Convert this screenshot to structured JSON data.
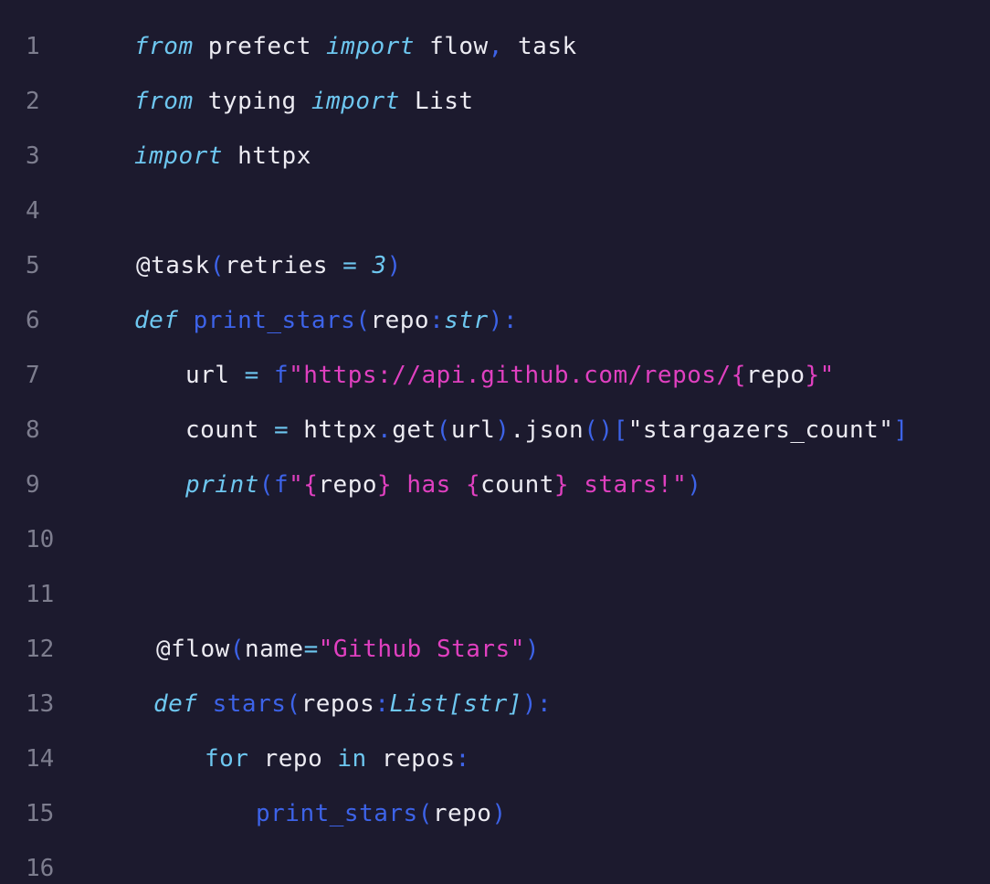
{
  "editor": {
    "theme_colors": {
      "background": "#1c1a2e",
      "line_number": "#7d7d8e",
      "keyword": "#6ec7f0",
      "identifier": "#ecebf2",
      "function": "#3d63e8",
      "string": "#e040c0"
    },
    "lines": [
      {
        "num": "1",
        "indent": 147,
        "tokens": [
          {
            "t": "from",
            "c": "kw"
          },
          {
            "t": " ",
            "c": "id"
          },
          {
            "t": "prefect",
            "c": "id"
          },
          {
            "t": " ",
            "c": "id"
          },
          {
            "t": "import",
            "c": "kw"
          },
          {
            "t": " ",
            "c": "id"
          },
          {
            "t": "flow",
            "c": "id"
          },
          {
            "t": ",",
            "c": "pn"
          },
          {
            "t": " ",
            "c": "id"
          },
          {
            "t": "task",
            "c": "id"
          }
        ]
      },
      {
        "num": "2",
        "indent": 147,
        "tokens": [
          {
            "t": "from",
            "c": "kw"
          },
          {
            "t": " ",
            "c": "id"
          },
          {
            "t": "typing",
            "c": "id"
          },
          {
            "t": " ",
            "c": "id"
          },
          {
            "t": "import",
            "c": "kw"
          },
          {
            "t": " ",
            "c": "id"
          },
          {
            "t": "List",
            "c": "id"
          }
        ]
      },
      {
        "num": "3",
        "indent": 147,
        "tokens": [
          {
            "t": "import",
            "c": "kw"
          },
          {
            "t": " ",
            "c": "id"
          },
          {
            "t": "httpx",
            "c": "id"
          }
        ]
      },
      {
        "num": "4",
        "indent": 147,
        "tokens": []
      },
      {
        "num": "5",
        "indent": 149,
        "tokens": [
          {
            "t": "@task",
            "c": "dec"
          },
          {
            "t": "(",
            "c": "pn"
          },
          {
            "t": "retries",
            "c": "id"
          },
          {
            "t": " ",
            "c": "id"
          },
          {
            "t": "=",
            "c": "kw-plain"
          },
          {
            "t": " ",
            "c": "id"
          },
          {
            "t": "3",
            "c": "num"
          },
          {
            "t": ")",
            "c": "pn"
          }
        ]
      },
      {
        "num": "6",
        "indent": 147,
        "tokens": [
          {
            "t": "def",
            "c": "kw"
          },
          {
            "t": " ",
            "c": "id"
          },
          {
            "t": "print_stars",
            "c": "fn"
          },
          {
            "t": "(",
            "c": "pn"
          },
          {
            "t": "repo",
            "c": "id"
          },
          {
            "t": ":",
            "c": "pn"
          },
          {
            "t": "str",
            "c": "typ"
          },
          {
            "t": "):",
            "c": "pn"
          }
        ]
      },
      {
        "num": "7",
        "indent": 203,
        "tokens": [
          {
            "t": "url",
            "c": "id"
          },
          {
            "t": " ",
            "c": "id"
          },
          {
            "t": "=",
            "c": "kw-plain"
          },
          {
            "t": " ",
            "c": "id"
          },
          {
            "t": "f",
            "c": "fn"
          },
          {
            "t": "\"https://api.github.com/repos/",
            "c": "str"
          },
          {
            "t": "{",
            "c": "str"
          },
          {
            "t": "repo",
            "c": "id"
          },
          {
            "t": "}",
            "c": "str"
          },
          {
            "t": "\"",
            "c": "str"
          }
        ]
      },
      {
        "num": "8",
        "indent": 203,
        "tokens": [
          {
            "t": "count",
            "c": "id"
          },
          {
            "t": " ",
            "c": "id"
          },
          {
            "t": "=",
            "c": "kw-plain"
          },
          {
            "t": " ",
            "c": "id"
          },
          {
            "t": "httpx",
            "c": "id"
          },
          {
            "t": ".",
            "c": "pn"
          },
          {
            "t": "get",
            "c": "id"
          },
          {
            "t": "(",
            "c": "pn"
          },
          {
            "t": "url",
            "c": "id"
          },
          {
            "t": ")",
            "c": "pn"
          },
          {
            "t": ".json",
            "c": "id"
          },
          {
            "t": "()",
            "c": "pn"
          },
          {
            "t": "[",
            "c": "pn"
          },
          {
            "t": "\"stargazers_count\"",
            "c": "id"
          },
          {
            "t": "]",
            "c": "pn"
          }
        ]
      },
      {
        "num": "9",
        "indent": 203,
        "tokens": [
          {
            "t": "print",
            "c": "kw"
          },
          {
            "t": "(",
            "c": "pn"
          },
          {
            "t": "f",
            "c": "fn"
          },
          {
            "t": "\"",
            "c": "str"
          },
          {
            "t": "{",
            "c": "str"
          },
          {
            "t": "repo",
            "c": "id"
          },
          {
            "t": "}",
            "c": "str"
          },
          {
            "t": " has ",
            "c": "str"
          },
          {
            "t": "{",
            "c": "str"
          },
          {
            "t": "count",
            "c": "id"
          },
          {
            "t": "}",
            "c": "str"
          },
          {
            "t": " stars!\"",
            "c": "str"
          },
          {
            "t": ")",
            "c": "pn"
          }
        ]
      },
      {
        "num": "10",
        "indent": 147,
        "tokens": []
      },
      {
        "num": "11",
        "indent": 147,
        "tokens": []
      },
      {
        "num": "12",
        "indent": 171,
        "tokens": [
          {
            "t": "@flow",
            "c": "dec"
          },
          {
            "t": "(",
            "c": "pn"
          },
          {
            "t": "name",
            "c": "id"
          },
          {
            "t": "=",
            "c": "kw-plain"
          },
          {
            "t": "\"Github Stars\"",
            "c": "str"
          },
          {
            "t": ")",
            "c": "pn"
          }
        ]
      },
      {
        "num": "13",
        "indent": 168,
        "tokens": [
          {
            "t": "def",
            "c": "kw"
          },
          {
            "t": " ",
            "c": "id"
          },
          {
            "t": "stars",
            "c": "fn"
          },
          {
            "t": "(",
            "c": "pn"
          },
          {
            "t": "repos",
            "c": "id"
          },
          {
            "t": ":",
            "c": "pn"
          },
          {
            "t": "List[str]",
            "c": "typ"
          },
          {
            "t": "):",
            "c": "pn"
          }
        ]
      },
      {
        "num": "14",
        "indent": 224,
        "tokens": [
          {
            "t": "for",
            "c": "kw-plain"
          },
          {
            "t": " ",
            "c": "id"
          },
          {
            "t": "repo",
            "c": "id"
          },
          {
            "t": " ",
            "c": "id"
          },
          {
            "t": "in",
            "c": "kw-plain"
          },
          {
            "t": " ",
            "c": "id"
          },
          {
            "t": "repos",
            "c": "id"
          },
          {
            "t": ":",
            "c": "pn"
          }
        ]
      },
      {
        "num": "15",
        "indent": 280,
        "tokens": [
          {
            "t": "print_stars",
            "c": "fn"
          },
          {
            "t": "(",
            "c": "pn"
          },
          {
            "t": "repo",
            "c": "id"
          },
          {
            "t": ")",
            "c": "pn"
          }
        ]
      },
      {
        "num": "16",
        "indent": 147,
        "tokens": []
      }
    ]
  }
}
